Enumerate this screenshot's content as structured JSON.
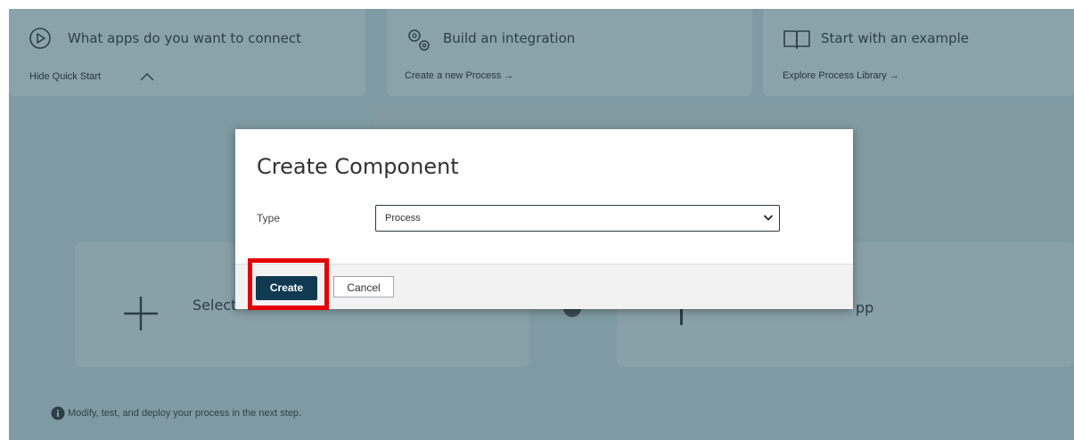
{
  "quick_start": {
    "card_connect": {
      "title": "What apps do you want to connect",
      "link": "Hide Quick Start",
      "icon": "play-circle-icon"
    },
    "card_build": {
      "title": "Build an integration",
      "link": "Create a new Process →",
      "icon": "gears-icon"
    },
    "card_example": {
      "title": "Start with an example",
      "link": "Explore Process Library →",
      "icon": "open-book-icon"
    }
  },
  "connect_cards": {
    "source_label": "Select",
    "target_label": "pp"
  },
  "hint_text": "Modify, test, and deploy your process in the next step.",
  "modal": {
    "title": "Create Component",
    "type_label": "Type",
    "type_value": "Process",
    "create_label": "Create",
    "cancel_label": "Cancel"
  },
  "colors": {
    "overlay": "#7f9aa3",
    "primary_button": "#0f3a52",
    "highlight": "#e30000"
  }
}
